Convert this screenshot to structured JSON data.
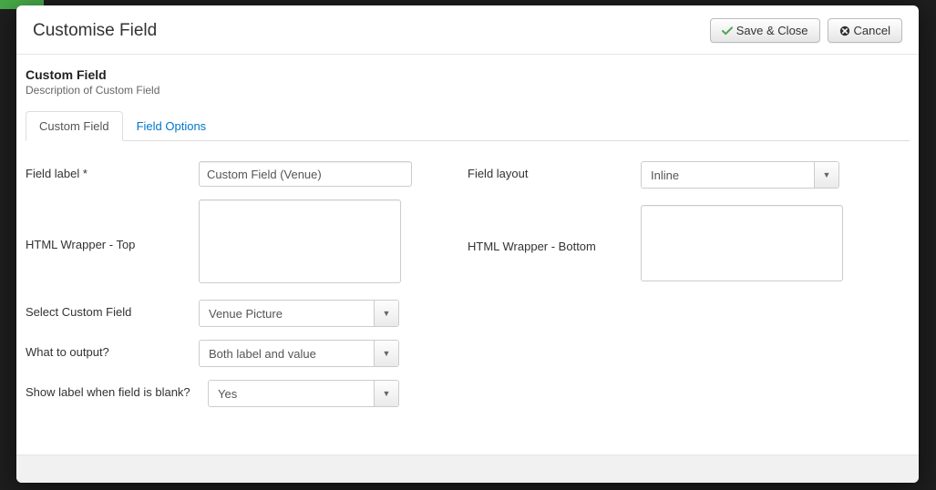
{
  "header": {
    "title": "Customise Field",
    "save_label": "Save & Close",
    "cancel_label": "Cancel"
  },
  "section": {
    "title": "Custom Field",
    "description": "Description of Custom Field"
  },
  "tabs": [
    {
      "label": "Custom Field",
      "active": true
    },
    {
      "label": "Field Options",
      "active": false
    }
  ],
  "form": {
    "field_label": {
      "label": "Field label *",
      "value": "Custom Field (Venue)"
    },
    "field_layout": {
      "label": "Field layout",
      "value": "Inline"
    },
    "html_wrapper_top": {
      "label": "HTML Wrapper - Top",
      "value": ""
    },
    "html_wrapper_bottom": {
      "label": "HTML Wrapper - Bottom",
      "value": ""
    },
    "select_custom_field": {
      "label": "Select Custom Field",
      "value": "Venue Picture"
    },
    "what_to_output": {
      "label": "What to output?",
      "value": "Both label and value"
    },
    "show_label_when_blank": {
      "label": "Show label when field is blank?",
      "value": "Yes"
    }
  }
}
